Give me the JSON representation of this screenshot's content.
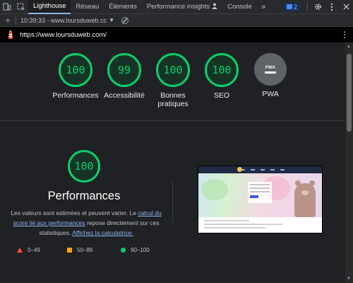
{
  "devtools": {
    "tabs": [
      {
        "label": "Lighthouse"
      },
      {
        "label": "Réseau"
      },
      {
        "label": "Éléments"
      },
      {
        "label": "Performance insights",
        "icon": "person-icon"
      },
      {
        "label": "Console"
      }
    ],
    "more_label": "»",
    "issues_count": "2",
    "icons": [
      "device-toolbar-icon",
      "inspect-icon",
      "gear-icon",
      "kebab-menu-icon",
      "close-icon"
    ]
  },
  "report_bar": {
    "new_report": "+",
    "selected_report": "10:39:33 - www.loursduweb.cc",
    "icons": [
      "add-icon",
      "dropdown-caret-icon",
      "clear-icon"
    ]
  },
  "url_bar": {
    "url": "https://www.loursduweb.com/",
    "icons": [
      "lighthouse-logo-icon",
      "kebab-menu-icon"
    ]
  },
  "gauges": [
    {
      "label": "Performances",
      "score": "100"
    },
    {
      "label": "Accessibilité",
      "score": "99"
    },
    {
      "label": "Bonnes pratiques",
      "score": "100"
    },
    {
      "label": "SEO",
      "score": "100"
    },
    {
      "label": "PWA",
      "badge": "PWA"
    }
  ],
  "performance": {
    "score": "100",
    "title": "Performances",
    "desc_1": "Les valeurs sont estimées et peuvent varier. Le ",
    "link_1": "calcul du score lié aux performances",
    "desc_2": " repose directement sur ces statistiques. ",
    "link_2": "Affichez la calculatrice."
  },
  "legend": [
    {
      "range": "0–49",
      "icon": "fail-triangle-icon",
      "color": "#ff4e42"
    },
    {
      "range": "50–89",
      "icon": "average-square-icon",
      "color": "#ffa400"
    },
    {
      "range": "90–100",
      "icon": "pass-circle-icon",
      "color": "#0cce6b"
    }
  ],
  "colors": {
    "pass": "#0cce6b",
    "accent": "#8ab4f8",
    "background": "#202124"
  }
}
